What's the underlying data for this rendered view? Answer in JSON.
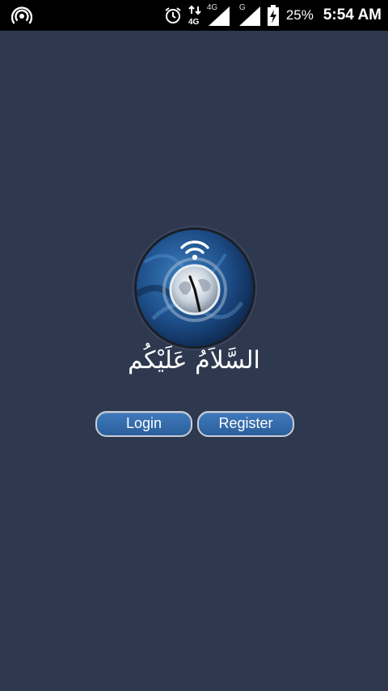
{
  "status_bar": {
    "network_label_1": "4G",
    "network_label_2": "G",
    "battery_percent": "25%",
    "time": "5:54 AM",
    "icons": [
      "hotspot-icon",
      "alarm-icon",
      "data-arrows-icon",
      "signal-icon",
      "signal-icon",
      "battery-charging-icon"
    ]
  },
  "app": {
    "logo_icon": "globe-clock-wifi-logo",
    "greeting": "السَّلاَمُ عَلَيْكُم",
    "login_label": "Login",
    "register_label": "Register",
    "colors": {
      "background": "#2e394f",
      "button": "#3f79bb",
      "button_border": "#c9cdd4"
    }
  }
}
